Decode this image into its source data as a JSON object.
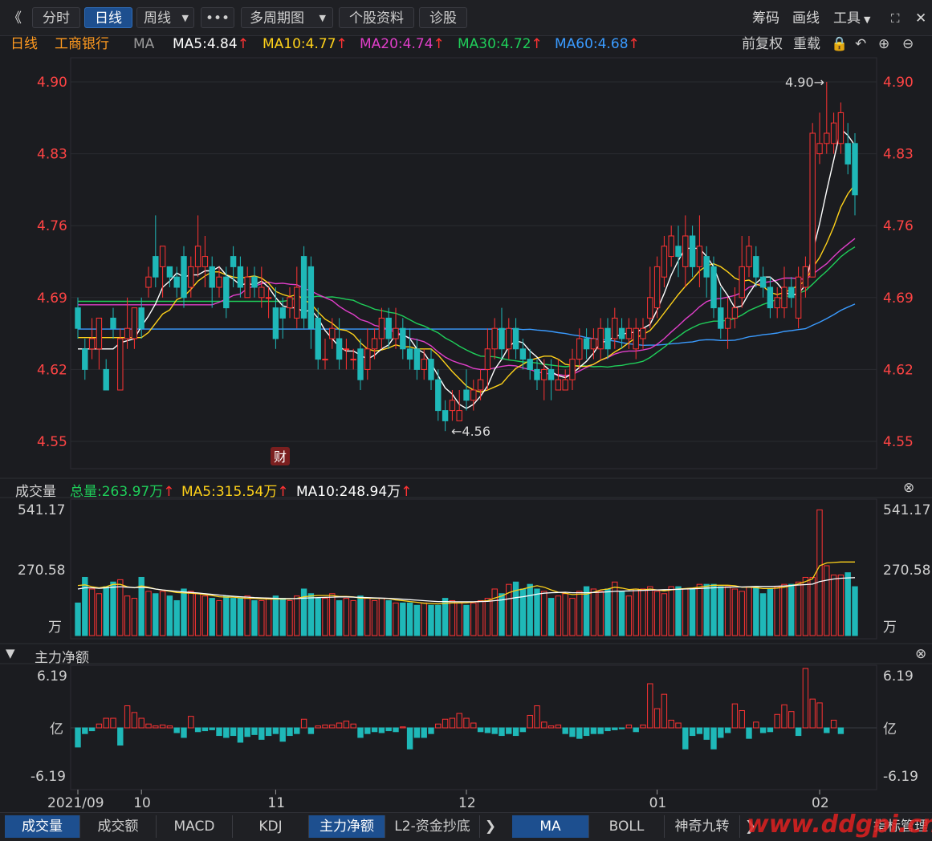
{
  "toolbar": {
    "back": "《",
    "tabs": [
      "分时",
      "日线",
      "周线",
      "•••",
      "多周期图",
      "个股资料",
      "诊股"
    ],
    "right": [
      "筹码",
      "画线",
      "工具"
    ]
  },
  "info": {
    "period": "日线",
    "stock": "工商银行",
    "ma_label": "MA",
    "ma5": "MA5:4.84",
    "ma10": "MA10:4.77",
    "ma20": "MA20:4.74",
    "ma30": "MA30:4.72",
    "ma60": "MA60:4.68",
    "right": [
      "前复权",
      "重载"
    ],
    "up_arrow": "↑"
  },
  "volume_header": {
    "title": "成交量",
    "total": "总量:263.97万",
    "ma5": "MA5:315.54万",
    "ma10": "MA10:248.94万"
  },
  "netflow_header": {
    "title": "主力净额"
  },
  "bottom_tabs": {
    "left": [
      "成交量",
      "成交额",
      "MACD",
      "KDJ",
      "主力净额",
      "L2-资金抄底"
    ],
    "right": [
      "MA",
      "BOLL",
      "神奇九转",
      "指标管理"
    ]
  },
  "watermark": "www.ddgpi.cn",
  "colors": {
    "up": "#ff3333",
    "down": "#1fb8b8",
    "ma5": "#ffffff",
    "ma10": "#ffd21a",
    "ma20": "#e03fc9",
    "ma30": "#1fcf5a",
    "ma60": "#3a9bff",
    "axis_red": "#ff4444"
  },
  "chart_data": {
    "type": "candlestick",
    "price_axis": {
      "ticks": [
        "4.90",
        "4.83",
        "4.76",
        "4.69",
        "4.62",
        "4.55"
      ],
      "range": [
        4.55,
        4.9
      ]
    },
    "x_ticks": [
      "2021/09",
      "10",
      "11",
      "12",
      "01",
      "02"
    ],
    "annotations": {
      "high": "4.90→",
      "low": "←4.56",
      "finance_marker": "财"
    },
    "candles": [
      [
        4.68,
        4.66,
        4.69,
        4.65
      ],
      [
        4.64,
        4.62,
        4.65,
        4.61
      ],
      [
        4.64,
        4.65,
        4.67,
        4.63
      ],
      [
        4.64,
        4.67,
        4.67,
        4.62
      ],
      [
        4.62,
        4.6,
        4.63,
        4.6
      ],
      [
        4.67,
        4.66,
        4.68,
        4.65
      ],
      [
        4.6,
        4.65,
        4.66,
        4.6
      ],
      [
        4.65,
        4.66,
        4.69,
        4.64
      ],
      [
        4.65,
        4.68,
        4.68,
        4.64
      ],
      [
        4.68,
        4.66,
        4.69,
        4.65
      ],
      [
        4.7,
        4.71,
        4.72,
        4.69
      ],
      [
        4.73,
        4.71,
        4.77,
        4.7
      ],
      [
        4.72,
        4.74,
        4.74,
        4.69
      ],
      [
        4.72,
        4.71,
        4.72,
        4.7
      ],
      [
        4.71,
        4.7,
        4.72,
        4.69
      ],
      [
        4.73,
        4.69,
        4.74,
        4.68
      ],
      [
        4.7,
        4.72,
        4.73,
        4.69
      ],
      [
        4.72,
        4.74,
        4.77,
        4.71
      ],
      [
        4.72,
        4.73,
        4.75,
        4.7
      ],
      [
        4.72,
        4.7,
        4.73,
        4.68
      ],
      [
        4.7,
        4.71,
        4.72,
        4.69
      ],
      [
        4.71,
        4.68,
        4.72,
        4.67
      ],
      [
        4.73,
        4.72,
        4.74,
        4.7
      ],
      [
        4.72,
        4.7,
        4.73,
        4.69
      ],
      [
        4.69,
        4.71,
        4.72,
        4.69
      ],
      [
        4.71,
        4.7,
        4.72,
        4.69
      ],
      [
        4.69,
        4.7,
        4.72,
        4.68
      ],
      [
        4.69,
        4.69,
        4.7,
        4.67
      ],
      [
        4.68,
        4.65,
        4.7,
        4.64
      ],
      [
        4.68,
        4.67,
        4.69,
        4.65
      ],
      [
        4.68,
        4.69,
        4.7,
        4.67
      ],
      [
        4.67,
        4.7,
        4.72,
        4.66
      ],
      [
        4.73,
        4.67,
        4.74,
        4.66
      ],
      [
        4.72,
        4.66,
        4.73,
        4.64
      ],
      [
        4.67,
        4.63,
        4.68,
        4.62
      ],
      [
        4.63,
        4.63,
        4.65,
        4.62
      ],
      [
        4.65,
        4.66,
        4.67,
        4.64
      ],
      [
        4.65,
        4.63,
        4.67,
        4.62
      ],
      [
        4.64,
        4.64,
        4.65,
        4.62
      ],
      [
        4.63,
        4.63,
        4.64,
        4.62
      ],
      [
        4.64,
        4.61,
        4.65,
        4.6
      ],
      [
        4.62,
        4.64,
        4.66,
        4.61
      ],
      [
        4.64,
        4.65,
        4.66,
        4.63
      ],
      [
        4.65,
        4.67,
        4.68,
        4.64
      ],
      [
        4.67,
        4.65,
        4.68,
        4.64
      ],
      [
        4.65,
        4.66,
        4.68,
        4.64
      ],
      [
        4.66,
        4.64,
        4.67,
        4.63
      ],
      [
        4.64,
        4.63,
        4.66,
        4.62
      ],
      [
        4.64,
        4.62,
        4.65,
        4.61
      ],
      [
        4.62,
        4.63,
        4.64,
        4.61
      ],
      [
        4.63,
        4.61,
        4.64,
        4.6
      ],
      [
        4.61,
        4.58,
        4.62,
        4.57
      ],
      [
        4.58,
        4.57,
        4.59,
        4.56
      ],
      [
        4.58,
        4.59,
        4.6,
        4.57
      ],
      [
        4.57,
        4.58,
        4.6,
        4.57
      ],
      [
        4.6,
        4.59,
        4.62,
        4.58
      ],
      [
        4.59,
        4.6,
        4.61,
        4.58
      ],
      [
        4.6,
        4.61,
        4.62,
        4.59
      ],
      [
        4.62,
        4.64,
        4.66,
        4.6
      ],
      [
        4.64,
        4.66,
        4.67,
        4.63
      ],
      [
        4.66,
        4.64,
        4.68,
        4.63
      ],
      [
        4.64,
        4.66,
        4.67,
        4.63
      ],
      [
        4.66,
        4.64,
        4.67,
        4.63
      ],
      [
        4.64,
        4.63,
        4.65,
        4.62
      ],
      [
        4.63,
        4.62,
        4.64,
        4.61
      ],
      [
        4.62,
        4.61,
        4.63,
        4.6
      ],
      [
        4.61,
        4.62,
        4.63,
        4.59
      ],
      [
        4.62,
        4.61,
        4.63,
        4.59
      ],
      [
        4.6,
        4.61,
        4.63,
        4.6
      ],
      [
        4.6,
        4.61,
        4.62,
        4.6
      ],
      [
        4.61,
        4.63,
        4.64,
        4.6
      ],
      [
        4.63,
        4.65,
        4.66,
        4.62
      ],
      [
        4.65,
        4.64,
        4.66,
        4.63
      ],
      [
        4.64,
        4.65,
        4.66,
        4.63
      ],
      [
        4.64,
        4.66,
        4.67,
        4.63
      ],
      [
        4.66,
        4.64,
        4.67,
        4.63
      ],
      [
        4.65,
        4.67,
        4.68,
        4.64
      ],
      [
        4.66,
        4.65,
        4.67,
        4.64
      ],
      [
        4.65,
        4.66,
        4.67,
        4.64
      ],
      [
        4.64,
        4.66,
        4.67,
        4.63
      ],
      [
        4.65,
        4.66,
        4.67,
        4.64
      ],
      [
        4.67,
        4.69,
        4.72,
        4.66
      ],
      [
        4.68,
        4.72,
        4.73,
        4.67
      ],
      [
        4.71,
        4.74,
        4.75,
        4.7
      ],
      [
        4.73,
        4.75,
        4.76,
        4.72
      ],
      [
        4.74,
        4.73,
        4.76,
        4.71
      ],
      [
        4.72,
        4.75,
        4.77,
        4.7
      ],
      [
        4.75,
        4.72,
        4.76,
        4.71
      ],
      [
        4.72,
        4.74,
        4.77,
        4.7
      ],
      [
        4.73,
        4.71,
        4.74,
        4.69
      ],
      [
        4.72,
        4.68,
        4.73,
        4.67
      ],
      [
        4.68,
        4.66,
        4.7,
        4.65
      ],
      [
        4.66,
        4.67,
        4.69,
        4.64
      ],
      [
        4.67,
        4.68,
        4.7,
        4.66
      ],
      [
        4.69,
        4.72,
        4.75,
        4.68
      ],
      [
        4.72,
        4.74,
        4.75,
        4.71
      ],
      [
        4.73,
        4.71,
        4.74,
        4.7
      ],
      [
        4.71,
        4.7,
        4.72,
        4.69
      ],
      [
        4.7,
        4.68,
        4.71,
        4.67
      ],
      [
        4.68,
        4.69,
        4.7,
        4.67
      ],
      [
        4.68,
        4.7,
        4.72,
        4.67
      ],
      [
        4.7,
        4.69,
        4.71,
        4.68
      ],
      [
        4.67,
        4.71,
        4.72,
        4.66
      ],
      [
        4.7,
        4.72,
        4.73,
        4.69
      ],
      [
        4.71,
        4.85,
        4.86,
        4.71
      ],
      [
        4.83,
        4.84,
        4.87,
        4.82
      ],
      [
        4.84,
        4.85,
        4.9,
        4.83
      ],
      [
        4.84,
        4.86,
        4.87,
        4.83
      ],
      [
        4.84,
        4.87,
        4.88,
        4.83
      ],
      [
        4.84,
        4.82,
        4.86,
        4.81
      ],
      [
        4.84,
        4.79,
        4.85,
        4.77
      ]
    ],
    "volume_axis": {
      "ticks": [
        "541.17",
        "270.58"
      ],
      "unit": "万",
      "max": 541.17
    },
    "volumes": [
      140,
      250,
      200,
      180,
      210,
      230,
      240,
      170,
      160,
      250,
      190,
      180,
      190,
      170,
      150,
      200,
      190,
      180,
      170,
      160,
      150,
      170,
      160,
      160,
      170,
      150,
      150,
      160,
      170,
      160,
      150,
      170,
      200,
      180,
      160,
      160,
      180,
      150,
      160,
      150,
      170,
      160,
      150,
      160,
      150,
      140,
      140,
      140,
      130,
      140,
      130,
      130,
      160,
      150,
      140,
      130,
      140,
      150,
      160,
      200,
      180,
      220,
      230,
      200,
      220,
      200,
      190,
      160,
      170,
      180,
      160,
      190,
      210,
      200,
      190,
      200,
      230,
      190,
      170,
      200,
      200,
      210,
      190,
      180,
      210,
      210,
      200,
      200,
      220,
      220,
      220,
      210,
      210,
      200,
      190,
      210,
      210,
      180,
      200,
      210,
      220,
      220,
      230,
      250,
      250,
      540,
      300,
      260,
      260,
      270,
      210
    ],
    "volume_ma5": [
      215,
      218,
      210,
      205,
      210,
      220,
      220,
      210,
      205,
      213,
      208,
      200,
      195,
      190,
      185,
      183,
      182,
      180,
      176,
      172,
      167,
      165,
      165,
      162,
      160,
      160,
      158,
      157,
      157,
      157,
      157,
      160,
      167,
      170,
      172,
      172,
      172,
      168,
      168,
      166,
      161,
      161,
      160,
      160,
      159,
      153,
      150,
      146,
      143,
      139,
      138,
      136,
      139,
      140,
      140,
      141,
      144,
      147,
      150,
      161,
      170,
      184,
      194,
      200,
      208,
      214,
      208,
      196,
      186,
      182,
      176,
      178,
      178,
      186,
      196,
      200,
      208,
      204,
      198,
      200,
      196,
      200,
      196,
      192,
      196,
      200,
      202,
      204,
      208,
      212,
      216,
      216,
      216,
      214,
      208,
      208,
      206,
      202,
      202,
      204,
      208,
      214,
      222,
      232,
      244,
      300,
      312,
      314,
      316,
      316,
      316
    ],
    "volume_ma10": [
      200,
      205,
      205,
      203,
      205,
      208,
      210,
      208,
      206,
      207,
      205,
      200,
      196,
      193,
      190,
      187,
      185,
      183,
      180,
      177,
      174,
      171,
      169,
      167,
      165,
      163,
      162,
      161,
      160,
      159,
      159,
      159,
      161,
      162,
      163,
      164,
      165,
      166,
      166,
      165,
      164,
      163,
      162,
      161,
      160,
      158,
      156,
      154,
      152,
      150,
      148,
      146,
      146,
      145,
      145,
      145,
      145,
      146,
      147,
      150,
      153,
      158,
      163,
      167,
      172,
      178,
      182,
      184,
      185,
      186,
      184,
      184,
      184,
      185,
      186,
      188,
      190,
      191,
      192,
      193,
      194,
      195,
      196,
      197,
      198,
      199,
      200,
      201,
      202,
      204,
      205,
      207,
      208,
      209,
      209,
      210,
      211,
      211,
      211,
      212,
      213,
      215,
      217,
      219,
      221,
      232,
      238,
      243,
      246,
      248,
      249
    ],
    "netflow_axis": {
      "ticks": [
        "6.19",
        "-6.19"
      ],
      "unit": "亿"
    },
    "netflow": [
      -2.0,
      -0.6,
      -0.3,
      0.4,
      1.0,
      1.0,
      -1.8,
      2.3,
      1.6,
      1.0,
      0.4,
      0.2,
      0.3,
      0.2,
      -0.5,
      -1.0,
      1.2,
      -0.4,
      -0.3,
      -0.2,
      -0.8,
      -1.0,
      -0.8,
      -1.5,
      -0.9,
      -0.7,
      -1.2,
      -0.8,
      -0.6,
      -1.4,
      -0.8,
      -0.6,
      0.9,
      -0.6,
      0.2,
      0.3,
      0.3,
      0.5,
      0.7,
      0.4,
      -1.0,
      -0.6,
      -0.4,
      -0.5,
      -0.3,
      -0.4,
      0.1,
      -2.2,
      -1.0,
      -1.0,
      -0.6,
      0.4,
      0.9,
      1.0,
      1.5,
      1.0,
      0.5,
      -0.4,
      -0.5,
      -0.6,
      -0.8,
      -0.6,
      -0.8,
      -0.4,
      1.3,
      2.3,
      0.6,
      0.2,
      0.3,
      -0.6,
      -0.9,
      -1.1,
      -0.8,
      -0.6,
      -0.6,
      -0.3,
      -0.2,
      -0.1,
      0.3,
      -0.4,
      0.3,
      4.6,
      2.0,
      3.5,
      0.8,
      0.5,
      -2.2,
      -0.8,
      -0.6,
      -1.2,
      -2.2,
      -1.0,
      -0.5,
      2.5,
      1.8,
      -1.1,
      0.6,
      -0.5,
      -0.4,
      1.4,
      2.4,
      1.7,
      -0.8,
      6.19,
      3.0,
      2.6,
      -0.5,
      0.8,
      -0.6
    ]
  }
}
